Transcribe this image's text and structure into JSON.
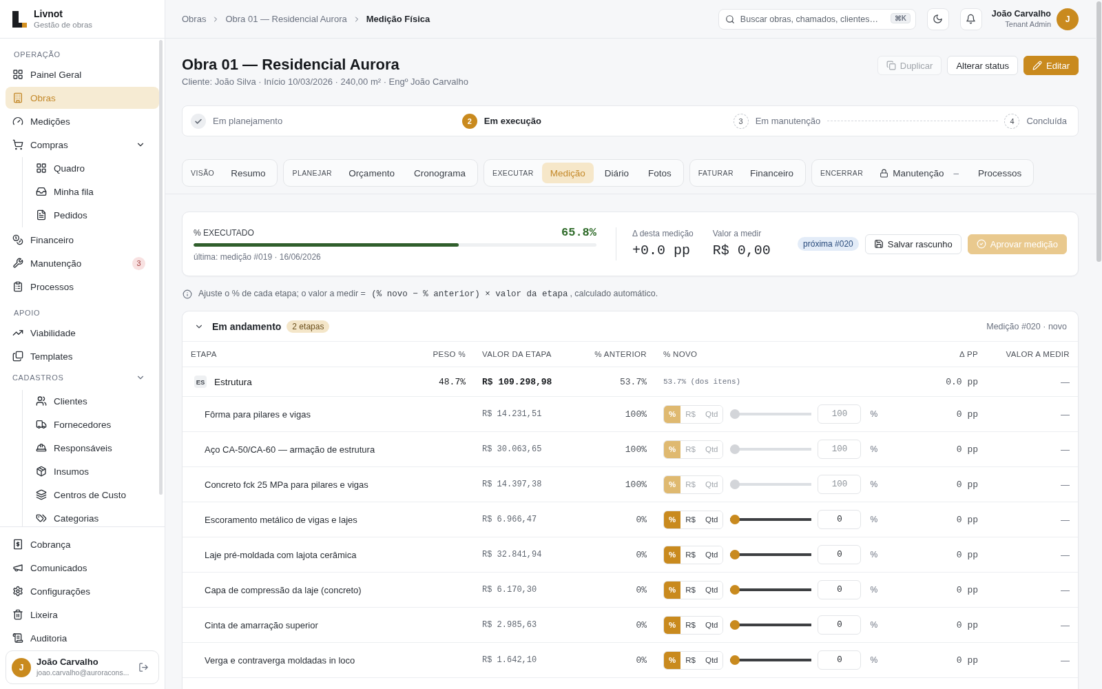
{
  "sidebar": {
    "brand": {
      "name": "Livnot",
      "tagline": "Gestão de obras"
    },
    "sections": [
      {
        "title": "OPERAÇÃO",
        "items": [
          {
            "label": "Painel Geral",
            "selected": false
          },
          {
            "label": "Obras",
            "selected": true
          },
          {
            "label": "Medições",
            "selected": false
          },
          {
            "label": "Compras",
            "selected": false,
            "expanded": true,
            "children": [
              {
                "label": "Quadro",
                "selected": false
              },
              {
                "label": "Minha fila",
                "selected": false
              },
              {
                "label": "Pedidos",
                "selected": false
              }
            ]
          },
          {
            "label": "Financeiro",
            "selected": false
          },
          {
            "label": "Manutenção",
            "selected": false,
            "badge": "3"
          },
          {
            "label": "Processos",
            "selected": false
          }
        ]
      },
      {
        "title": "APOIO",
        "items": [
          {
            "label": "Viabilidade",
            "selected": false
          },
          {
            "label": "Templates",
            "selected": false
          }
        ]
      },
      {
        "title": "CADASTROS",
        "expanded": true,
        "items": [
          {
            "label": "Clientes",
            "selected": false
          },
          {
            "label": "Fornecedores",
            "selected": false
          },
          {
            "label": "Responsáveis",
            "selected": false
          },
          {
            "label": "Insumos",
            "selected": false
          },
          {
            "label": "Centros de Custo",
            "selected": false
          },
          {
            "label": "Categorias",
            "selected": false
          }
        ]
      }
    ],
    "footer_items": [
      {
        "label": "Cobrança",
        "selected": false
      },
      {
        "label": "Comunicados",
        "selected": false
      },
      {
        "label": "Configurações",
        "selected": false
      },
      {
        "label": "Lixeira",
        "selected": false
      },
      {
        "label": "Auditoria",
        "selected": false
      }
    ],
    "user": {
      "initial": "J",
      "name": "João Carvalho",
      "email": "joao.carvalho@auroracons..."
    }
  },
  "topbar": {
    "breadcrumb": [
      {
        "label": "Obras",
        "current": false
      },
      {
        "label": "Obra 01 — Residencial Aurora",
        "current": false
      },
      {
        "label": "Medição Física",
        "current": true
      }
    ],
    "search": {
      "placeholder": "Buscar obras, chamados, clientes…",
      "shortcut": "⌘K"
    },
    "user": {
      "name": "João Carvalho",
      "role": "Tenant Admin",
      "initial": "J"
    }
  },
  "page_header": {
    "title": "Obra 01 — Residencial Aurora",
    "subtitle": "Cliente: João Silva · Início 10/03/2026 · 240,00 m² · Engº João Carvalho",
    "actions": [
      {
        "label": "Duplicar",
        "kind": "secondary",
        "disabled": true
      },
      {
        "label": "Alterar status",
        "kind": "secondary",
        "disabled": false
      },
      {
        "label": "Editar",
        "kind": "primary",
        "disabled": false
      }
    ]
  },
  "stepper": {
    "stages": [
      {
        "label": "Em planejamento",
        "completed": true,
        "active": false
      },
      {
        "number": "2",
        "label": "Em execução",
        "completed": false,
        "active": true
      },
      {
        "number": "3",
        "label": "Em manutenção",
        "completed": false,
        "active": false
      },
      {
        "number": "4",
        "label": "Concluída",
        "completed": false,
        "active": false
      }
    ]
  },
  "tab_groups": [
    {
      "title": "VISÃO",
      "tabs": [
        {
          "label": "Resumo",
          "selected": false,
          "locked": false
        }
      ]
    },
    {
      "title": "PLANEJAR",
      "tabs": [
        {
          "label": "Orçamento",
          "selected": false,
          "locked": false
        },
        {
          "label": "Cronograma",
          "selected": false,
          "locked": false
        }
      ]
    },
    {
      "title": "EXECUTAR",
      "tabs": [
        {
          "label": "Medição",
          "selected": true,
          "locked": false
        },
        {
          "label": "Diário",
          "selected": false,
          "locked": false
        },
        {
          "label": "Fotos",
          "selected": false,
          "locked": false
        }
      ]
    },
    {
      "title": "FATURAR",
      "tabs": [
        {
          "label": "Financeiro",
          "selected": false,
          "locked": false
        }
      ]
    },
    {
      "title": "ENCERRAR",
      "tabs": [
        {
          "label": "Manutenção",
          "selected": false,
          "locked": true,
          "count": "–"
        },
        {
          "label": "Processos",
          "selected": false,
          "locked": false
        }
      ]
    }
  ],
  "measurement": {
    "progress": {
      "label": "% EXECUTADO",
      "value": "65.8%",
      "level": 0.658,
      "note": "última: medição #019 · 16/06/2026"
    },
    "stats": [
      {
        "label": "Δ desta medição",
        "value": "+0.0 pp"
      },
      {
        "label": "Valor a medir",
        "value": "R$ 0,00"
      }
    ],
    "badge": "próxima #020",
    "actions": [
      {
        "label": "Salvar rascunho",
        "kind": "secondary",
        "disabled": false
      },
      {
        "label": "Aprovar medição",
        "kind": "primary",
        "disabled": true
      }
    ]
  },
  "hint": {
    "text": "Ajuste o % de cada etapa; o valor a medir =",
    "formula": "(% novo − % anterior) × valor da etapa",
    "suffix": ", calculado automático."
  },
  "table_group": {
    "title": "Em andamento",
    "count": "2 etapas",
    "expanded": true,
    "meta": "Medição #020 · novo",
    "columns": [
      "ETAPA",
      "PESO %",
      "VALOR DA ETAPA",
      "% ANTERIOR",
      "% NOVO",
      "Δ PP",
      "VALOR A MEDIR"
    ],
    "rows": [
      {
        "kind": "stage",
        "code": "ES",
        "name": "Estrutura",
        "weight": "48.7%",
        "value": "R$ 109.298,98",
        "previous": "53.7%",
        "new": "53.7% (dos itens)",
        "delta": "0.0 pp",
        "to_measure": "—"
      },
      {
        "kind": "item",
        "name": "Fôrma para pilares e vigas",
        "value": "R$ 14.231,51",
        "previous": "100%",
        "disabled": true,
        "modes": [
          {
            "label": "%",
            "selected": true
          },
          {
            "label": "R$",
            "selected": false
          },
          {
            "label": "Qtd",
            "selected": false
          }
        ],
        "level": 0,
        "input": "100",
        "unit": "%",
        "delta": "0 pp",
        "to_measure": "—"
      },
      {
        "kind": "item",
        "name": "Aço CA-50/CA-60 — armação de estrutura",
        "value": "R$ 30.063,65",
        "previous": "100%",
        "disabled": true,
        "modes": [
          {
            "label": "%",
            "selected": true
          },
          {
            "label": "R$",
            "selected": false
          },
          {
            "label": "Qtd",
            "selected": false
          }
        ],
        "level": 0,
        "input": "100",
        "unit": "%",
        "delta": "0 pp",
        "to_measure": "—"
      },
      {
        "kind": "item",
        "name": "Concreto fck 25 MPa para pilares e vigas",
        "value": "R$ 14.397,38",
        "previous": "100%",
        "disabled": true,
        "modes": [
          {
            "label": "%",
            "selected": true
          },
          {
            "label": "R$",
            "selected": false
          },
          {
            "label": "Qtd",
            "selected": false
          }
        ],
        "level": 0,
        "input": "100",
        "unit": "%",
        "delta": "0 pp",
        "to_measure": "—"
      },
      {
        "kind": "item",
        "name": "Escoramento metálico de vigas e lajes",
        "value": "R$ 6.966,47",
        "previous": "0%",
        "disabled": false,
        "modes": [
          {
            "label": "%",
            "selected": true
          },
          {
            "label": "R$",
            "selected": false
          },
          {
            "label": "Qtd",
            "selected": false
          }
        ],
        "level": 0,
        "input": "0",
        "unit": "%",
        "delta": "0 pp",
        "to_measure": "—"
      },
      {
        "kind": "item",
        "name": "Laje pré-moldada com lajota cerâmica",
        "value": "R$ 32.841,94",
        "previous": "0%",
        "disabled": false,
        "modes": [
          {
            "label": "%",
            "selected": true
          },
          {
            "label": "R$",
            "selected": false
          },
          {
            "label": "Qtd",
            "selected": false
          }
        ],
        "level": 0,
        "input": "0",
        "unit": "%",
        "delta": "0 pp",
        "to_measure": "—"
      },
      {
        "kind": "item",
        "name": "Capa de compressão da laje (concreto)",
        "value": "R$ 6.170,30",
        "previous": "0%",
        "disabled": false,
        "modes": [
          {
            "label": "%",
            "selected": true
          },
          {
            "label": "R$",
            "selected": false
          },
          {
            "label": "Qtd",
            "selected": false
          }
        ],
        "level": 0,
        "input": "0",
        "unit": "%",
        "delta": "0 pp",
        "to_measure": "—"
      },
      {
        "kind": "item",
        "name": "Cinta de amarração superior",
        "value": "R$ 2.985,63",
        "previous": "0%",
        "disabled": false,
        "modes": [
          {
            "label": "%",
            "selected": true
          },
          {
            "label": "R$",
            "selected": false
          },
          {
            "label": "Qtd",
            "selected": false
          }
        ],
        "level": 0,
        "input": "0",
        "unit": "%",
        "delta": "0 pp",
        "to_measure": "—"
      },
      {
        "kind": "item",
        "name": "Verga e contraverga moldadas in loco",
        "value": "R$ 1.642,10",
        "previous": "0%",
        "disabled": false,
        "modes": [
          {
            "label": "%",
            "selected": true
          },
          {
            "label": "R$",
            "selected": false
          },
          {
            "label": "Qtd",
            "selected": false
          }
        ],
        "level": 0,
        "input": "0",
        "unit": "%",
        "delta": "0 pp",
        "to_measure": "—"
      }
    ]
  }
}
